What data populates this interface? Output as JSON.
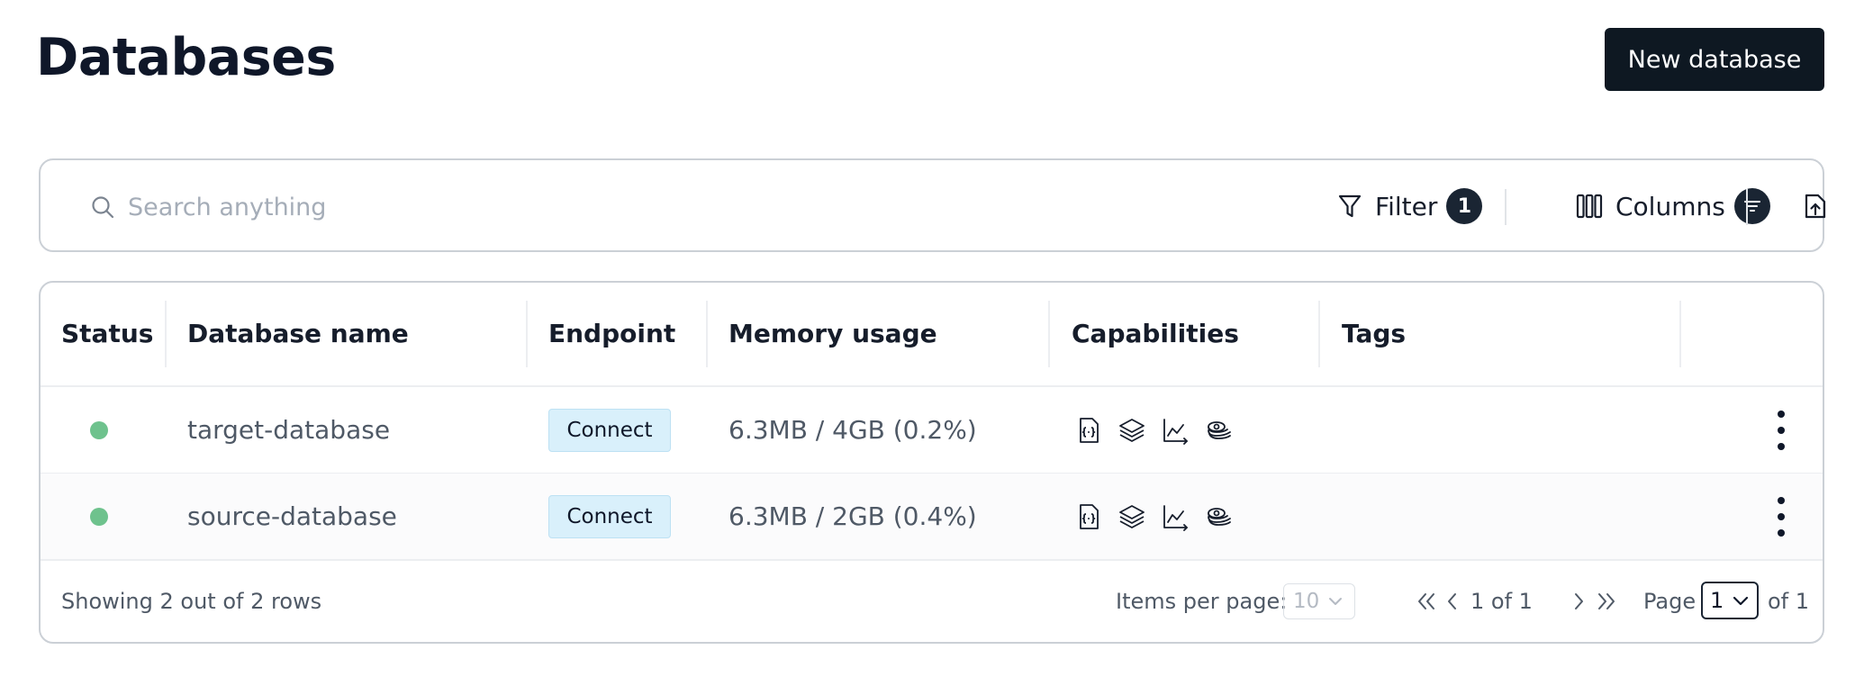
{
  "page": {
    "title": "Databases",
    "new_button": "New database"
  },
  "toolbar": {
    "search_placeholder": "Search anything",
    "filter_label": "Filter",
    "filter_count": "1",
    "columns_label": "Columns"
  },
  "table": {
    "columns": [
      "Status",
      "Database name",
      "Endpoint",
      "Memory usage",
      "Capabilities",
      "Tags"
    ],
    "rows": [
      {
        "status": "active",
        "name": "target-database",
        "endpoint": "Connect",
        "memory": "6.3MB / 4GB (0.2%)",
        "capabilities": [
          "json-icon",
          "layers-icon",
          "timeseries-chart-icon",
          "probabilistic-icon"
        ]
      },
      {
        "status": "active",
        "name": "source-database",
        "endpoint": "Connect",
        "memory": "6.3MB / 2GB (0.4%)",
        "capabilities": [
          "json-icon",
          "layers-icon",
          "timeseries-chart-icon",
          "probabilistic-icon"
        ]
      }
    ]
  },
  "footer": {
    "showing": "Showing 2 out of 2 rows",
    "items_per_page_label": "Items per page:",
    "items_per_page": "10",
    "range": "1 of 1",
    "page_label": "Page",
    "page": "1",
    "of_total": "of 1"
  },
  "colors": {
    "primary": "#0e1822",
    "status_active": "#6ec28d",
    "connect_bg": "#d9f0fb",
    "border": "#cbd0d6"
  }
}
